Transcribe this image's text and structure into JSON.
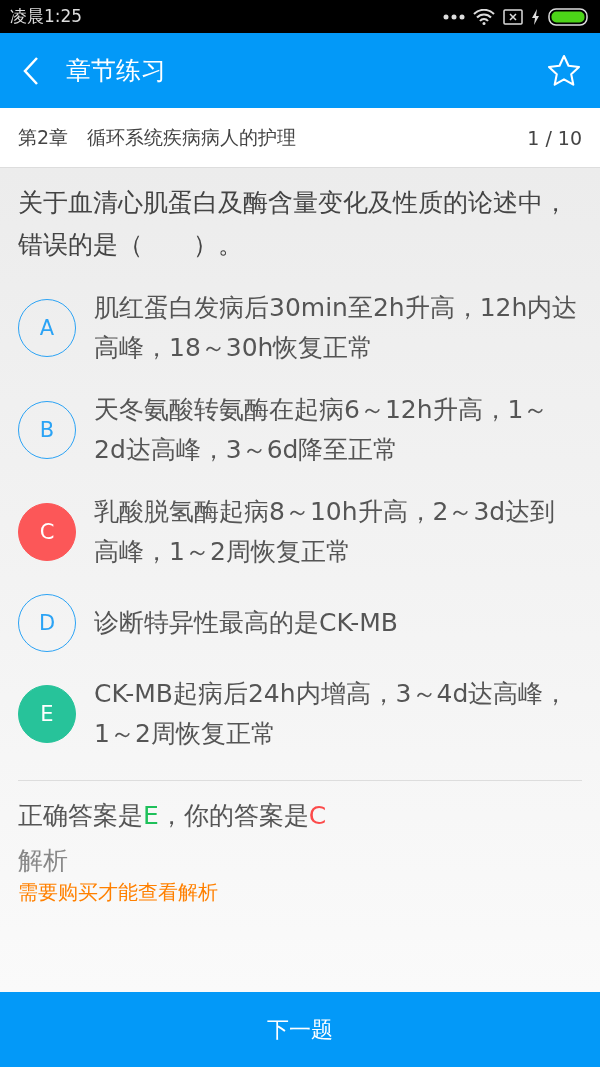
{
  "status_bar": {
    "time": "凌晨1:25"
  },
  "header": {
    "title": "章节练习",
    "favorited": false
  },
  "chapter": {
    "name": "第2章　循环系统疾病病人的护理",
    "counter": "1 / 10"
  },
  "question": "关于血清心肌蛋白及酶含量变化及性质的论述中，错误的是（　　）。",
  "options": [
    {
      "letter": "A",
      "text": "肌红蛋白发病后30min至2h升高，12h内达高峰，18～30h恢复正常",
      "kind": "normal"
    },
    {
      "letter": "B",
      "text": "天冬氨酸转氨酶在起病6～12h升高，1～2d达高峰，3～6d降至正常",
      "kind": "normal"
    },
    {
      "letter": "C",
      "text": "乳酸脱氢酶起病8～10h升高，2～3d达到高峰，1～2周恢复正常",
      "kind": "wrong"
    },
    {
      "letter": "D",
      "text": "诊断特异性最高的是CK-MB",
      "kind": "normal"
    },
    {
      "letter": "E",
      "text": "CK-MB起病后24h内增高，3～4d达高峰，1～2周恢复正常",
      "kind": "correct"
    }
  ],
  "result": {
    "correct_label": "正确答案是",
    "correct": "E",
    "separator": "，你的答案是",
    "yours": "C"
  },
  "analysis": {
    "title": "解析",
    "notice": "需要购买才能查看解析"
  },
  "next_button": "下一题"
}
